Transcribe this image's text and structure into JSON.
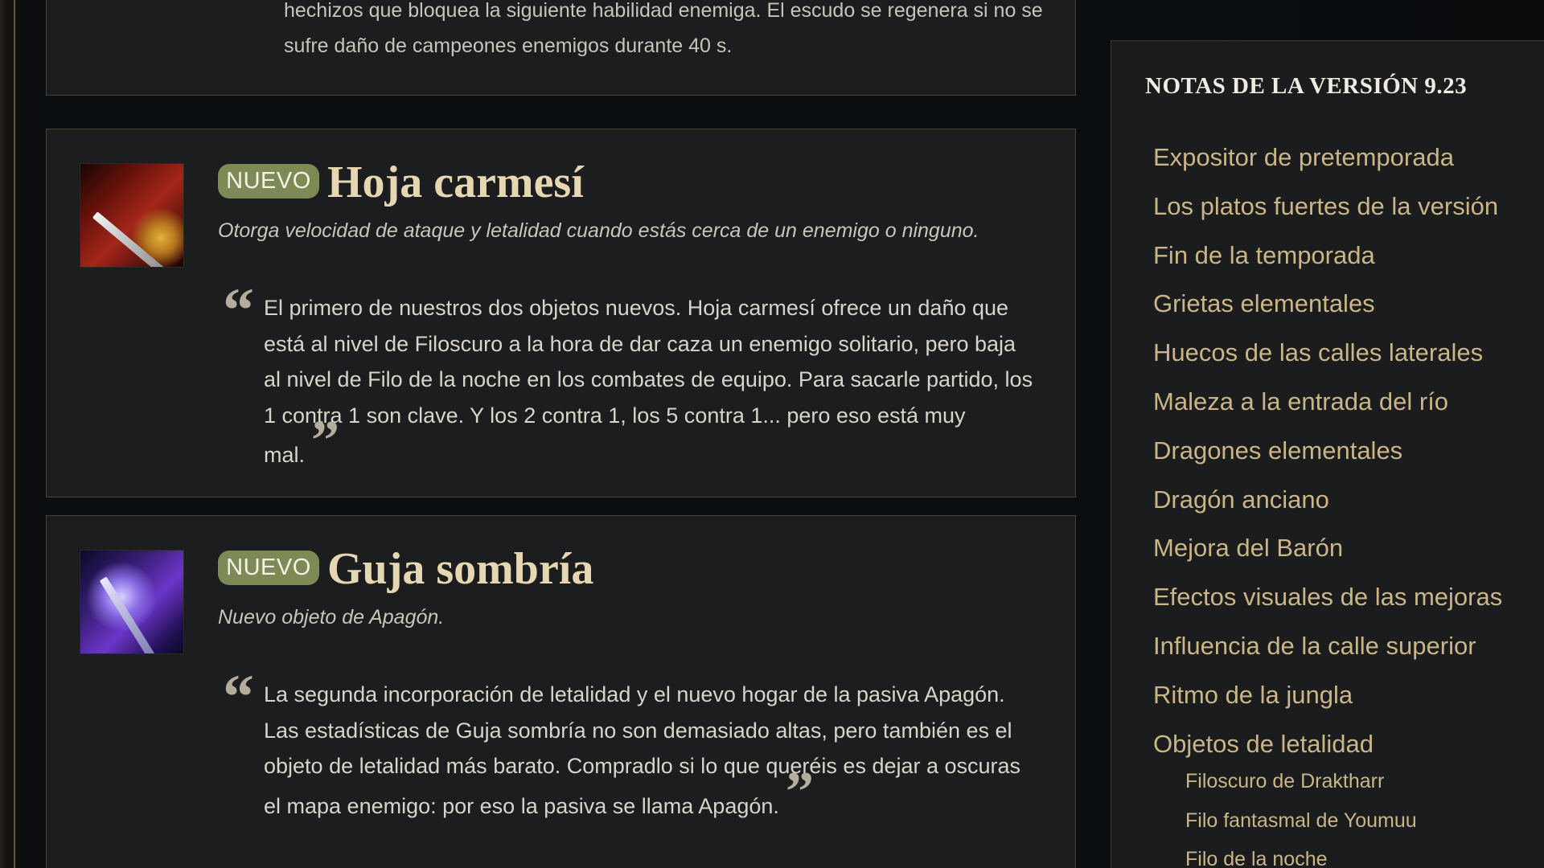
{
  "top_card": {
    "text": "hechizos que bloquea la siguiente habilidad enemiga. El escudo se regenera si no se sufre daño de campeones enemigos durante 40 s."
  },
  "items": [
    {
      "badge": "NUEVO",
      "title": "Hoja carmesí",
      "subtitle": "Otorga velocidad de ataque y letalidad cuando estás cerca de un enemigo o ninguno.",
      "quote": "El primero de nuestros dos objetos nuevos. Hoja carmesí ofrece un daño que está al nivel de Filoscuro a la hora de dar caza un enemigo solitario, pero baja al nivel de Filo de la noche en los combates de equipo. Para sacarle partido, los 1 contra 1 son clave. Y los 2 contra 1, los 5 contra 1... pero eso está muy mal.",
      "icon": "crimson-blade-icon"
    },
    {
      "badge": "NUEVO",
      "title": "Guja sombría",
      "subtitle": "Nuevo objeto de Apagón.",
      "quote": "La segunda incorporación de letalidad y el nuevo hogar de la pasiva Apagón. Las estadísticas de Guja sombría no son demasiado altas, pero también es el objeto de letalidad más barato. Compradlo si lo que queréis es dejar a oscuras el mapa enemigo: por eso la pasiva se llama Apagón.",
      "icon": "shadow-glaive-icon"
    }
  ],
  "quote_marks": {
    "open": "“",
    "close": "”"
  },
  "sidebar": {
    "title": "NOTAS DE LA VERSIÓN 9.23",
    "items": [
      "Expositor de pretemporada",
      "Los platos fuertes de la versión",
      "Fin de la temporada",
      "Grietas elementales",
      "Huecos de las calles laterales",
      "Maleza a la entrada del río",
      "Dragones elementales",
      "Dragón anciano",
      "Mejora del Barón",
      "Efectos visuales de las mejoras",
      "Influencia de la calle superior",
      "Ritmo de la jungla",
      "Objetos de letalidad"
    ],
    "sub_items": [
      "Filoscuro de Draktharr",
      "Filo fantasmal de Youmuu",
      "Filo de la noche"
    ]
  },
  "colors": {
    "accent_gold": "#cbb586",
    "badge_green": "#7d8a55",
    "title_cream": "#e7d6b2"
  }
}
